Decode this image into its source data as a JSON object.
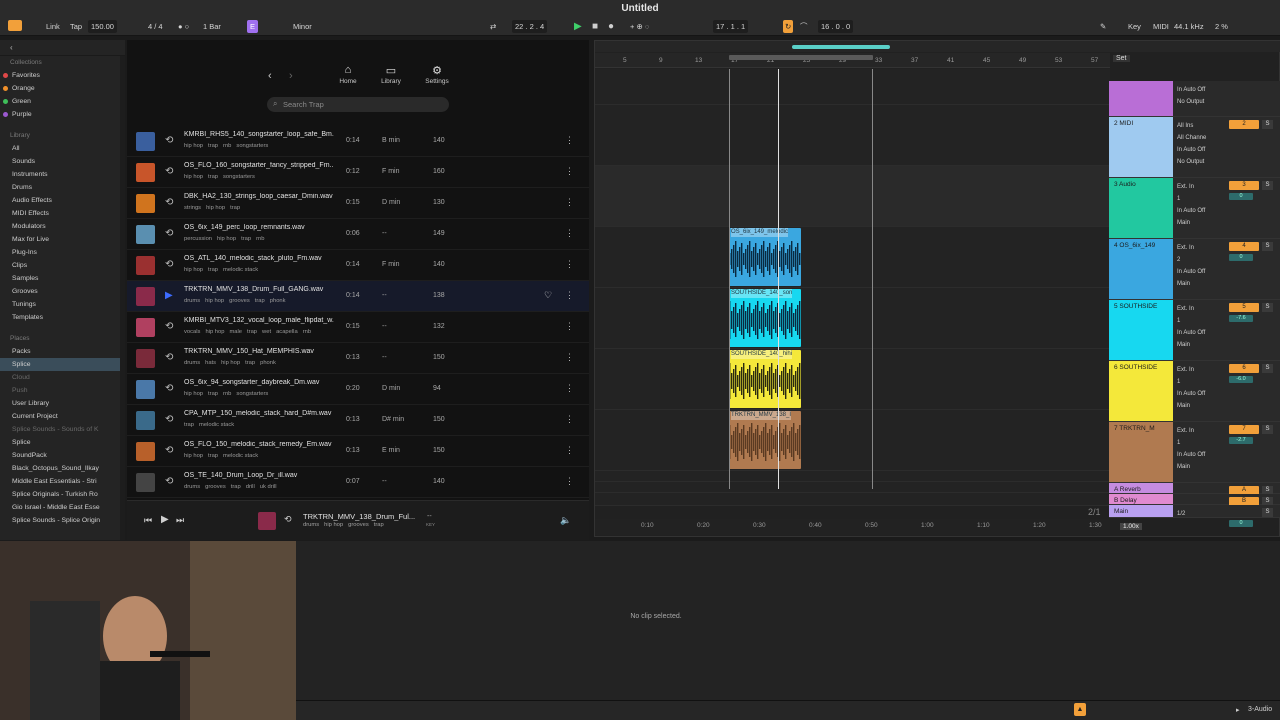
{
  "window": {
    "title": "Untitled"
  },
  "transport": {
    "link": "Link",
    "tap": "Tap",
    "tempo": "150.00",
    "signature": "4 / 4",
    "quantize": "1 Bar",
    "key_root": "E",
    "key_scale": "Minor",
    "position": "22 .  2 .  4",
    "loop_start": "17 .  1 .  1",
    "loop_length": "16 .  0 .  0",
    "key_label": "Key",
    "midi_label": "MIDI",
    "sample_rate": "44.1 kHz",
    "cpu": "2 %"
  },
  "sidebar": {
    "collections_label": "Collections",
    "collections": [
      {
        "label": "Favorites",
        "color": "#e04848"
      },
      {
        "label": "Orange",
        "color": "#f0902a"
      },
      {
        "label": "Green",
        "color": "#3fbf5a"
      },
      {
        "label": "Purple",
        "color": "#9b59d0"
      }
    ],
    "library_label": "Library",
    "library": [
      "All",
      "Sounds",
      "Instruments",
      "Drums",
      "Audio Effects",
      "MIDI Effects",
      "Modulators",
      "Max for Live",
      "Plug-Ins",
      "Clips",
      "Samples",
      "Grooves",
      "Tunings",
      "Templates"
    ],
    "places_label": "Places",
    "places": [
      "Packs",
      "Splice",
      "Cloud",
      "Push",
      "User Library",
      "Current Project",
      "Splice Sounds - Sounds of K",
      "Splice",
      "SoundPack",
      "Black_Octopus_Sound_Ilkay",
      "Middle East Essentials - Stri",
      "Splice Originals - Turkish Ro",
      "Gio Israel - Middle East Esse",
      "Splice Sounds - Splice Origin"
    ]
  },
  "splice": {
    "nav": {
      "home": "Home",
      "library": "Library",
      "settings": "Settings"
    },
    "search_placeholder": "Search Trap",
    "samples": [
      {
        "name": "KMRBI_RHS5_140_songstarter_loop_safe_Bm...",
        "tags": [
          "hip hop",
          "trap",
          "rnb",
          "songstarters"
        ],
        "duration": "0:14",
        "key": "B min",
        "bpm": "140",
        "art": "#3a5f9e"
      },
      {
        "name": "OS_FLO_160_songstarter_fancy_stripped_Fm...",
        "tags": [
          "hip hop",
          "trap",
          "songstarters"
        ],
        "duration": "0:12",
        "key": "F min",
        "bpm": "160",
        "art": "#c8552a"
      },
      {
        "name": "DBK_HA2_130_strings_loop_caesar_Dmin.wav",
        "tags": [
          "strings",
          "hip hop",
          "trap"
        ],
        "duration": "0:15",
        "key": "D min",
        "bpm": "130",
        "art": "#d0741e"
      },
      {
        "name": "OS_6ix_149_perc_loop_remnants.wav",
        "tags": [
          "percussion",
          "hip hop",
          "trap",
          "rnb"
        ],
        "duration": "0:06",
        "key": "--",
        "bpm": "149",
        "art": "#5a8fb0"
      },
      {
        "name": "OS_ATL_140_melodic_stack_pluto_Fm.wav",
        "tags": [
          "hip hop",
          "trap",
          "melodic stack"
        ],
        "duration": "0:14",
        "key": "F min",
        "bpm": "140",
        "art": "#9a3030"
      },
      {
        "name": "TRKTRN_MMV_138_Drum_Full_GANG.wav",
        "tags": [
          "drums",
          "hip hop",
          "grooves",
          "trap",
          "phonk"
        ],
        "duration": "0:14",
        "key": "--",
        "bpm": "138",
        "art": "#8a2a4a"
      },
      {
        "name": "KMRBI_MTV3_132_vocal_loop_male_flipdat_w...",
        "tags": [
          "vocals",
          "hip hop",
          "male",
          "trap",
          "wet",
          "acapella",
          "rnb"
        ],
        "duration": "0:15",
        "key": "--",
        "bpm": "132",
        "art": "#b04060"
      },
      {
        "name": "TRKTRN_MMV_150_Hat_MEMPHIS.wav",
        "tags": [
          "drums",
          "hats",
          "hip hop",
          "trap",
          "phonk"
        ],
        "duration": "0:13",
        "key": "--",
        "bpm": "150",
        "art": "#7a2a3a"
      },
      {
        "name": "OS_6ix_94_songstarter_daybreak_Dm.wav",
        "tags": [
          "hip hop",
          "trap",
          "rnb",
          "songstarters"
        ],
        "duration": "0:20",
        "key": "D min",
        "bpm": "94",
        "art": "#4a78a8"
      },
      {
        "name": "CPA_MTP_150_melodic_stack_hard_D#m.wav",
        "tags": [
          "trap",
          "melodic stack"
        ],
        "duration": "0:13",
        "key": "D# min",
        "bpm": "150",
        "art": "#3a6a8a"
      },
      {
        "name": "OS_FLO_150_melodic_stack_remedy_Em.wav",
        "tags": [
          "hip hop",
          "trap",
          "melodic stack"
        ],
        "duration": "0:13",
        "key": "E min",
        "bpm": "150",
        "art": "#b8602a"
      },
      {
        "name": "OS_TE_140_Drum_Loop_Dr_ill.wav",
        "tags": [
          "drums",
          "grooves",
          "trap",
          "drill",
          "uk drill"
        ],
        "duration": "0:07",
        "key": "--",
        "bpm": "140",
        "art": "#444444"
      }
    ],
    "player": {
      "name": "TRKTRN_MMV_138_Drum_Ful...",
      "tags": [
        "drums",
        "hip hop",
        "grooves",
        "trap"
      ],
      "key": "--",
      "key_label": "KEY"
    }
  },
  "arrangement": {
    "bar_labels": [
      "5",
      "9",
      "13",
      "17",
      "21",
      "25",
      "29",
      "33",
      "37",
      "41",
      "45",
      "49",
      "53",
      "57"
    ],
    "time_labels": [
      "0:10",
      "0:20",
      "0:30",
      "0:40",
      "0:50",
      "1:00",
      "1:10",
      "1:20",
      "1:30"
    ],
    "set_label": "Set",
    "zoom": "1.00x",
    "page_indicator": "2/1",
    "clips": [
      {
        "label": "OS_6ix_149_melodic",
        "color": "#3aa7e0"
      },
      {
        "label": "SOUTHSIDE_140_son",
        "color": "#17d8f0"
      },
      {
        "label": "SOUTHSIDE_140_hihi",
        "color": "#f4e83a"
      },
      {
        "label": "TRKTRN_MMV_138_I",
        "color": "#b07a50"
      }
    ],
    "tracks": [
      {
        "name": "",
        "color": "#b96ed6",
        "io": [
          "In Auto Off",
          "No Output"
        ],
        "num": "",
        "s": ""
      },
      {
        "name": "2 MIDI",
        "color": "#9fcaf0",
        "io": [
          "All Ins",
          "All Channe",
          "In Auto Off",
          "No Output"
        ],
        "num": "2",
        "s": "S"
      },
      {
        "name": "3 Audio",
        "color": "#22c8a0",
        "io": [
          "Ext. In",
          "1",
          "In Auto Off",
          "Main"
        ],
        "num": "3",
        "s": "S",
        "ret": "0"
      },
      {
        "name": "4 OS_6ix_149",
        "color": "#3aa7e0",
        "io": [
          "Ext. In",
          "2",
          "In Auto Off",
          "Main"
        ],
        "num": "4",
        "s": "S",
        "ret": "0"
      },
      {
        "name": "5 SOUTHSIDE",
        "color": "#17d8f0",
        "io": [
          "Ext. In",
          "1",
          "In Auto Off",
          "Main"
        ],
        "num": "5",
        "s": "S",
        "ret": "-7.6"
      },
      {
        "name": "6 SOUTHSIDE",
        "color": "#f4e83a",
        "io": [
          "Ext. In",
          "1",
          "In Auto Off",
          "Main"
        ],
        "num": "6",
        "s": "S",
        "ret": "-6.0"
      },
      {
        "name": "7 TRKTRN_M",
        "color": "#b07a50",
        "io": [
          "Ext. In",
          "1",
          "In Auto Off",
          "Main"
        ],
        "num": "7",
        "s": "S",
        "ret": "-2.7"
      },
      {
        "name": "A Reverb",
        "color": "#c58ce0",
        "io": [],
        "num": "A",
        "s": "S"
      },
      {
        "name": "B Delay",
        "color": "#e08ad0",
        "io": [],
        "num": "B",
        "s": "S"
      },
      {
        "name": "Main",
        "color": "#b9a0f0",
        "io": [
          "1/2"
        ],
        "num": "",
        "s": "S",
        "ret": "0"
      }
    ]
  },
  "detail": {
    "message": "No clip selected."
  },
  "status": {
    "track": "3-Audio"
  }
}
